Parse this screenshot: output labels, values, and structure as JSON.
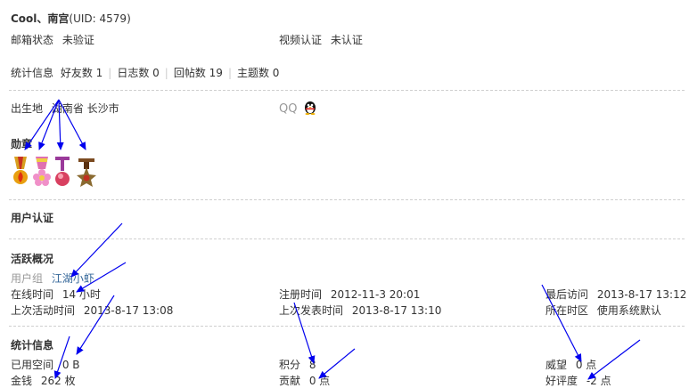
{
  "profile": {
    "username": "Cool、南宫",
    "uid": "(UID: 4579)"
  },
  "verify": {
    "email_label": "邮箱状态",
    "email_value": "未验证",
    "video_label": "视频认证",
    "video_value": "未认证"
  },
  "stats": {
    "label": "统计信息",
    "friends": "好友数 1",
    "blogs": "日志数 0",
    "replies": "回帖数 19",
    "threads": "主题数 0",
    "divider": "|"
  },
  "personal": {
    "birthplace_label": "出生地",
    "birthplace_value": "湖南省 长沙市",
    "qq_label": "QQ",
    "qq_icon": "qq-penguin-icon"
  },
  "medals": {
    "title": "勋章",
    "items": [
      {
        "icon": "medal-gold-fire-icon",
        "ribbon": "#d8a020",
        "body": "#e8a010"
      },
      {
        "icon": "medal-pink-flower-icon",
        "ribbon": "#e070b0",
        "body": "#f090c8"
      },
      {
        "icon": "medal-purple-orb-icon",
        "ribbon": "#9a3a9a",
        "body": "#d84060"
      },
      {
        "icon": "medal-bronze-star-icon",
        "ribbon": "#7a4a20",
        "body": "#8a6a30"
      }
    ]
  },
  "auth": {
    "title": "用户认证"
  },
  "activity": {
    "title": "活跃概况",
    "group_label": "用户组",
    "group_value": "江湖小虾",
    "online_label": "在线时间",
    "online_value": "14 小时",
    "register_label": "注册时间",
    "register_value": "2012-11-3 20:01",
    "last_visit_label": "最后访问",
    "last_visit_value": "2013-8-17 13:12",
    "last_active_label": "上次活动时间",
    "last_active_value": "2013-8-17 13:08",
    "last_post_label": "上次发表时间",
    "last_post_value": "2013-8-17 13:10",
    "timezone_label": "所在时区",
    "timezone_value": "使用系统默认"
  },
  "statistics": {
    "title": "统计信息",
    "space_label": "已用空间",
    "space_value": "0 B",
    "points_label": "积分",
    "points_value": "8",
    "prestige_label": "威望",
    "prestige_value": "0 点",
    "money_label": "金钱",
    "money_value": "262 枚",
    "contribution_label": "贡献",
    "contribution_value": "0 点",
    "rating_label": "好评度",
    "rating_value": "-2 点"
  },
  "colors": {
    "arrow": "#0000ee",
    "link": "#336699",
    "divider": "#cfcfcf",
    "qq_body": "#111111",
    "qq_beak": "#f0b000",
    "qq_scarf": "#e02020"
  }
}
